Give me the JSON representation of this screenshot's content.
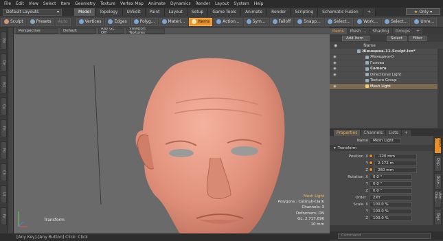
{
  "menu": [
    "File",
    "Edit",
    "View",
    "Select",
    "Item",
    "Geometry",
    "Texture",
    "Vertex Map",
    "Animate",
    "Dynamics",
    "Render",
    "Layout",
    "System",
    "Help"
  ],
  "layout_select": "Default Layouts",
  "layout_tabs": [
    "Model",
    "Topology",
    "UVEdit",
    "Paint",
    "Layout",
    "Setup",
    "Game Tools",
    "Animate",
    "Render",
    "Scripting",
    "Schematic Fusion",
    "+"
  ],
  "only_label": "Only",
  "toolbar": {
    "sculpt": "Sculpt",
    "presets": "Presets",
    "auto": "Auto",
    "vertices": "Vertices",
    "edges": "Edges",
    "polygons": "Polyg...",
    "materials": "Materi...",
    "items": "Items",
    "action": "Action...",
    "symmetry": "Sym...",
    "falloff": "Falloff",
    "snapping": "Snapp...",
    "select1": "Select...",
    "work": "Work...",
    "select2": "Select...",
    "unreal": "Unre..."
  },
  "left_strip": [
    "Ba",
    "De",
    "Ed",
    "Cu",
    "Pa",
    "Po",
    "Ch",
    "Ut",
    "Pa"
  ],
  "viewport": {
    "view": "Perspective",
    "style": "Default",
    "raygl": "Ray GL: Off",
    "textures": "Viewport Textures",
    "info": {
      "item": "Mesh Light",
      "polygons": "Polygons : Catmull-Clark",
      "channels": "Channels: 3",
      "deformers": "Deformers: ON",
      "gl": "GL: 2,717,696",
      "scale": "10 mm"
    },
    "transform_label": "Transform"
  },
  "status": "[Any Key]-[Any Button] Click:  Click",
  "right_panel": {
    "tabs": [
      "Items",
      "Mesh ...",
      "Shading",
      "Groups",
      "+"
    ],
    "add_item": "Add Item",
    "select_btn": "Select",
    "filter_btn": "Filter",
    "name_header": "Name",
    "items": [
      {
        "name": "Женщина-11-Sculpt.lxo*",
        "indent": 0,
        "eye": "",
        "selected": false,
        "bold": true
      },
      {
        "name": "Женщина-0",
        "indent": 2,
        "eye": "◉",
        "selected": false,
        "bold": false
      },
      {
        "name": "Голова",
        "indent": 2,
        "eye": "◉",
        "selected": false,
        "bold": false
      },
      {
        "name": "Camera",
        "indent": 2,
        "eye": "◉",
        "selected": false,
        "bold": true
      },
      {
        "name": "Directional Light",
        "indent": 2,
        "eye": "◉",
        "selected": false,
        "bold": false
      },
      {
        "name": "Texture Group",
        "indent": 2,
        "eye": "",
        "selected": false,
        "bold": false
      },
      {
        "name": "Mesh Light",
        "indent": 2,
        "eye": "◉",
        "selected": true,
        "bold": false
      }
    ]
  },
  "properties": {
    "tabs": [
      "Properties",
      "Channels",
      "Lists",
      "+"
    ],
    "name_label": "Name",
    "name_value": "Mesh Light",
    "section": "Transform",
    "rows": [
      {
        "group": "Position",
        "axis": "X",
        "value": "-120 mm",
        "dot": true
      },
      {
        "group": "",
        "axis": "Y",
        "value": "2.172 m",
        "dot": true
      },
      {
        "group": "",
        "axis": "Z",
        "value": "260 mm",
        "dot": true
      },
      {
        "group": "Rotation",
        "axis": "X",
        "value": "0.0 °",
        "dot": false
      },
      {
        "group": "",
        "axis": "Y",
        "value": "0.0 °",
        "dot": false
      },
      {
        "group": "",
        "axis": "Z",
        "value": "0.0 °",
        "dot": false
      },
      {
        "group": "Order",
        "axis": "",
        "value": "ZXY",
        "dot": false
      },
      {
        "group": "Scale",
        "axis": "X",
        "value": "100.0 %",
        "dot": false
      },
      {
        "group": "",
        "axis": "Y",
        "value": "100.0 %",
        "dot": false
      },
      {
        "group": "",
        "axis": "Z",
        "value": "100.0 %",
        "dot": false
      }
    ],
    "vtabs": [
      "Mesh L...",
      "Disp...",
      "Asse...",
      "User Cha...",
      "Tags"
    ]
  },
  "command_placeholder": "Command",
  "colors": {
    "accent": "#e8902a",
    "selected_row": "#7a6a52",
    "viewport": "#6a6a6a",
    "skin": "#e0907a"
  }
}
